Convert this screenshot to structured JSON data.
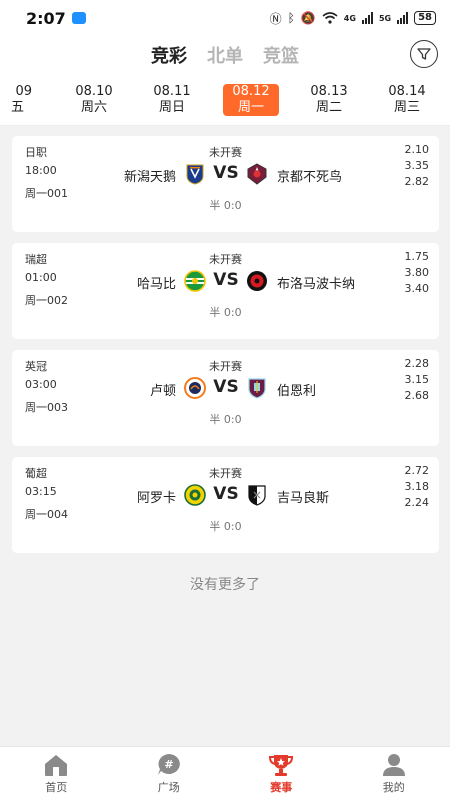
{
  "status_bar": {
    "time": "2:07",
    "net4g": "4G",
    "net5g": "5G",
    "battery": "58"
  },
  "header": {
    "tabs": [
      {
        "label": "竞彩",
        "active": true
      },
      {
        "label": "北单",
        "active": false
      },
      {
        "label": "竞篮",
        "active": false
      }
    ]
  },
  "dates": [
    {
      "date": "09",
      "weekday": "五",
      "active": false
    },
    {
      "date": "08.10",
      "weekday": "周六",
      "active": false
    },
    {
      "date": "08.11",
      "weekday": "周日",
      "active": false
    },
    {
      "date": "08.12",
      "weekday": "周一",
      "active": true
    },
    {
      "date": "08.13",
      "weekday": "周二",
      "active": false
    },
    {
      "date": "08.14",
      "weekday": "周三",
      "active": false
    }
  ],
  "matches": [
    {
      "league": "日职",
      "kickoff": "18:00",
      "number": "周一001",
      "status": "未开赛",
      "home": "新潟天鹅",
      "away": "京都不死鸟",
      "vs": "VS",
      "halftime": "半 0:0",
      "odds": [
        "2.10",
        "3.35",
        "2.82"
      ],
      "home_logo": "albirex-niigata-crest-icon",
      "away_logo": "kyoto-sanga-crest-icon"
    },
    {
      "league": "瑞超",
      "kickoff": "01:00",
      "number": "周一002",
      "status": "未开赛",
      "home": "哈马比",
      "away": "布洛马波卡纳",
      "vs": "VS",
      "halftime": "半 0:0",
      "odds": [
        "1.75",
        "3.80",
        "3.40"
      ],
      "home_logo": "hammarby-crest-icon",
      "away_logo": "brommapojkarna-crest-icon"
    },
    {
      "league": "英冠",
      "kickoff": "03:00",
      "number": "周一003",
      "status": "未开赛",
      "home": "卢顿",
      "away": "伯恩利",
      "vs": "VS",
      "halftime": "半 0:0",
      "odds": [
        "2.28",
        "3.15",
        "2.68"
      ],
      "home_logo": "luton-town-crest-icon",
      "away_logo": "burnley-crest-icon"
    },
    {
      "league": "葡超",
      "kickoff": "03:15",
      "number": "周一004",
      "status": "未开赛",
      "home": "阿罗卡",
      "away": "吉马良斯",
      "vs": "VS",
      "halftime": "半 0:0",
      "odds": [
        "2.72",
        "3.18",
        "2.24"
      ],
      "home_logo": "arouca-crest-icon",
      "away_logo": "vitoria-guimaraes-crest-icon"
    }
  ],
  "no_more": "没有更多了",
  "bottom_nav": [
    {
      "label": "首页",
      "icon": "home-icon",
      "active": false
    },
    {
      "label": "广场",
      "icon": "hashtag-chat-icon",
      "active": false
    },
    {
      "label": "赛事",
      "icon": "trophy-icon",
      "active": true
    },
    {
      "label": "我的",
      "icon": "user-icon",
      "active": false
    }
  ],
  "colors": {
    "accent": "#ff6a2b",
    "active_nav": "#e33a2b"
  }
}
